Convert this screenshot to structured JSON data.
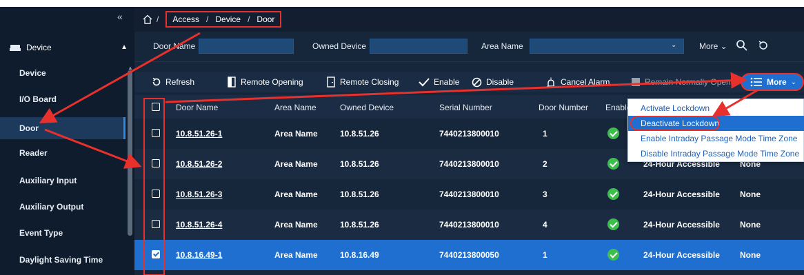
{
  "sidebar": {
    "collapse_glyph": "«",
    "section_label": "Device",
    "section_icon": "device-icon",
    "section_caret": "▲",
    "items": [
      {
        "label": "Device",
        "active": false
      },
      {
        "label": "I/O Board",
        "active": false
      },
      {
        "label": "Door",
        "active": true
      },
      {
        "label": "Reader",
        "active": false
      },
      {
        "label": "Auxiliary Input",
        "active": false
      },
      {
        "label": "Auxiliary Output",
        "active": false
      },
      {
        "label": "Event Type",
        "active": false
      },
      {
        "label": "Daylight Saving Time",
        "active": false
      }
    ]
  },
  "breadcrumb": {
    "home_icon": "home-icon",
    "root_sep": "/",
    "items": [
      "Access",
      "Device",
      "Door"
    ],
    "sep": "/"
  },
  "filter": {
    "door_name_label": "Door Name",
    "door_name_value": "",
    "owned_device_label": "Owned Device",
    "owned_device_value": "",
    "area_name_label": "Area Name",
    "area_name_value": "",
    "area_caret": "⌄",
    "more_label": "More ⌄"
  },
  "toolbar": {
    "refresh": "Refresh",
    "remote_opening": "Remote Opening",
    "remote_closing": "Remote Closing",
    "enable": "Enable",
    "disable": "Disable",
    "cancel_alarm": "Cancel Alarm",
    "remain_open": "Remain Normally Open",
    "more": "More"
  },
  "more_menu": {
    "items": [
      "Activate Lockdown",
      "Deactivate Lockdown",
      "Enable Intraday Passage Mode Time Zone",
      "Disable Intraday Passage Mode Time Zone"
    ],
    "highlighted_index": 1
  },
  "table": {
    "columns": [
      "Door Name",
      "Area Name",
      "Owned Device",
      "Serial Number",
      "Door Number",
      "Enable"
    ],
    "rows": [
      {
        "door_name": "10.8.51.26-1",
        "area_name": "Area Name",
        "owned_device": "10.8.51.26",
        "serial": "7440213800010",
        "door_number": "1",
        "enabled": true,
        "mode": "",
        "extra": "",
        "checked": false
      },
      {
        "door_name": "10.8.51.26-2",
        "area_name": "Area Name",
        "owned_device": "10.8.51.26",
        "serial": "7440213800010",
        "door_number": "2",
        "enabled": true,
        "mode": "24-Hour Accessible",
        "extra": "None",
        "checked": false
      },
      {
        "door_name": "10.8.51.26-3",
        "area_name": "Area Name",
        "owned_device": "10.8.51.26",
        "serial": "7440213800010",
        "door_number": "3",
        "enabled": true,
        "mode": "24-Hour Accessible",
        "extra": "None",
        "checked": false
      },
      {
        "door_name": "10.8.51.26-4",
        "area_name": "Area Name",
        "owned_device": "10.8.51.26",
        "serial": "7440213800010",
        "door_number": "4",
        "enabled": true,
        "mode": "24-Hour Accessible",
        "extra": "None",
        "checked": false
      },
      {
        "door_name": "10.8.16.49-1",
        "area_name": "Area Name",
        "owned_device": "10.8.16.49",
        "serial": "7440213800050",
        "door_number": "1",
        "enabled": true,
        "mode": "24-Hour Accessible",
        "extra": "None",
        "checked": true
      }
    ]
  },
  "colors": {
    "background": "#16263b",
    "sidebar": "#0f1c2d",
    "accent": "#1e6fd0",
    "annotation_red": "#e8302c",
    "enabled_green": "#3cc04b"
  }
}
